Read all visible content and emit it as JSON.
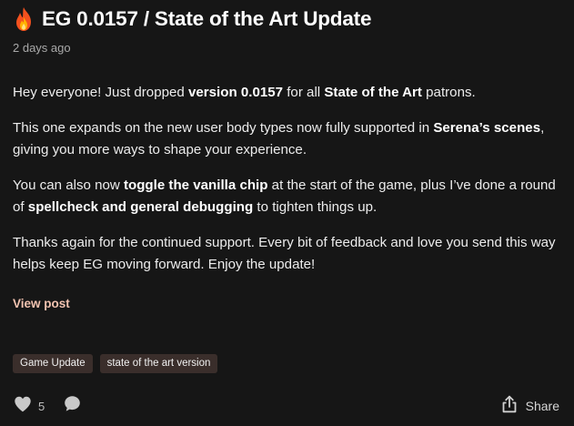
{
  "post": {
    "title": "EG 0.0157 / State of the Art Update",
    "title_icon": "fire-icon",
    "date": "2 days ago",
    "paragraphs": [
      {
        "parts": [
          {
            "text": "Hey everyone! Just dropped ",
            "bold": false
          },
          {
            "text": "version 0.0157",
            "bold": true
          },
          {
            "text": " for all ",
            "bold": false
          },
          {
            "text": "State of the Art",
            "bold": true
          },
          {
            "text": " patrons.",
            "bold": false
          }
        ]
      },
      {
        "parts": [
          {
            "text": "This one expands on the new user body types now fully supported in ",
            "bold": false
          },
          {
            "text": "Serena’s scenes",
            "bold": true
          },
          {
            "text": ", giving you more ways to shape your experience.",
            "bold": false
          }
        ]
      },
      {
        "parts": [
          {
            "text": "You can also now ",
            "bold": false
          },
          {
            "text": "toggle the vanilla chip",
            "bold": true
          },
          {
            "text": " at the start of the game, plus I’ve done a round of ",
            "bold": false
          },
          {
            "text": "spellcheck and general debugging",
            "bold": true
          },
          {
            "text": " to tighten things up.",
            "bold": false
          }
        ]
      },
      {
        "parts": [
          {
            "text": "Thanks again for the continued support. Every bit of feedback and love you send this way helps keep EG moving forward. Enjoy the update!",
            "bold": false
          }
        ]
      }
    ],
    "view_post_label": "View post",
    "tags": [
      "Game Update",
      "state of the art version"
    ]
  },
  "footer": {
    "like_count": "5",
    "like_icon": "heart-icon",
    "comment_icon": "comment-icon",
    "share_icon": "share-icon",
    "share_label": "Share"
  },
  "colors": {
    "background": "#161616",
    "text": "#ececec",
    "muted": "#a9a9a9",
    "link": "#f2c3b0",
    "tag_bg": "#3a2e2b",
    "icon": "#c9c9c9"
  }
}
